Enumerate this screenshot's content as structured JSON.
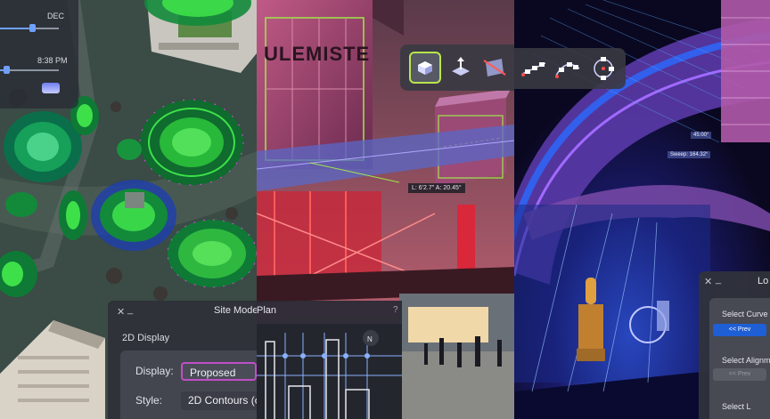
{
  "panel_site": {
    "time_widget": {
      "month": "DEC",
      "time": "8:38 PM",
      "month_progress": 0.55,
      "time_progress": 0.1
    },
    "dialog": {
      "close_glyph": "✕",
      "minimize_glyph": "_",
      "title": "Site Model",
      "section": "2D Display",
      "display_label": "Display:",
      "display_value": "Proposed",
      "style_label": "Style:",
      "style_value": "2D Contours (c"
    },
    "contour_accent": "#3ee04a",
    "marker_color": "#e04ae0"
  },
  "panel_building": {
    "sign_text": "ULEMISTE",
    "plan_dialog_title": "Plan",
    "help_glyph": "?",
    "north_label": "N",
    "measurement_label": "L: 6'2.7\"  A: 20.45°",
    "tools": [
      "box-tool-icon",
      "push-pull-icon",
      "section-plane-icon"
    ],
    "active_tool_accent": "#b7e64e"
  },
  "panel_stage": {
    "angle_label": "45.00°",
    "sweep_label": "Sweep: 164.32°",
    "tools": [
      "linear-array-icon",
      "path-array-icon",
      "polar-array-icon"
    ],
    "dialog": {
      "close_glyph": "✕",
      "minimize_glyph": "_",
      "title": "Lo",
      "select_curve_label": "Select Curve",
      "curve_prev_label": "<< Prev",
      "select_alignment_label": "Select Alignmen",
      "alignment_prev_label": "<< Prev",
      "select_label_partial": "Select L"
    }
  }
}
